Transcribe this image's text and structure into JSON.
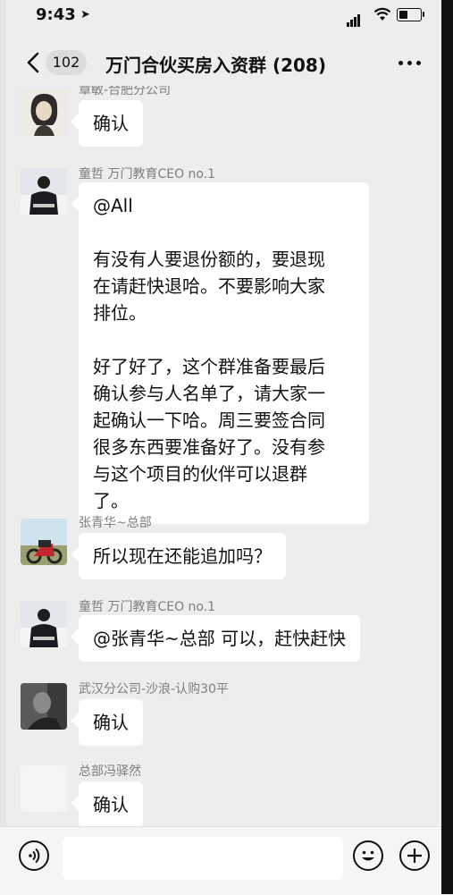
{
  "status": {
    "time": "9:43",
    "location_glyph": "➤"
  },
  "header": {
    "back_count": "102",
    "title": "万门合伙买房入资群 (208)"
  },
  "messages": [
    {
      "sender": "章敏-合肥分公司",
      "text": "确认"
    },
    {
      "sender": "童哲 万门教育CEO no.1",
      "text": "@All\n\n有没有人要退份额的，要退现\n在请赶快退哈。不要影响大家\n排位。\n\n好了好了，这个群准备要最后\n确认参与人名单了，请大家一\n起确认一下哈。周三要签合同\n很多东西要准备好了。没有参\n与这个项目的伙伴可以退群\n了。"
    },
    {
      "sender": "张青华~总部",
      "text": "所以现在还能追加吗？"
    },
    {
      "sender": "童哲 万门教育CEO no.1",
      "text": "@张青华~总部 可以，赶快赶快"
    },
    {
      "sender": "武汉分公司-沙浪-认购30平",
      "text": "确认"
    },
    {
      "sender": "总部冯驿然",
      "text": "确认"
    }
  ],
  "input": {
    "value": "",
    "placeholder": ""
  }
}
